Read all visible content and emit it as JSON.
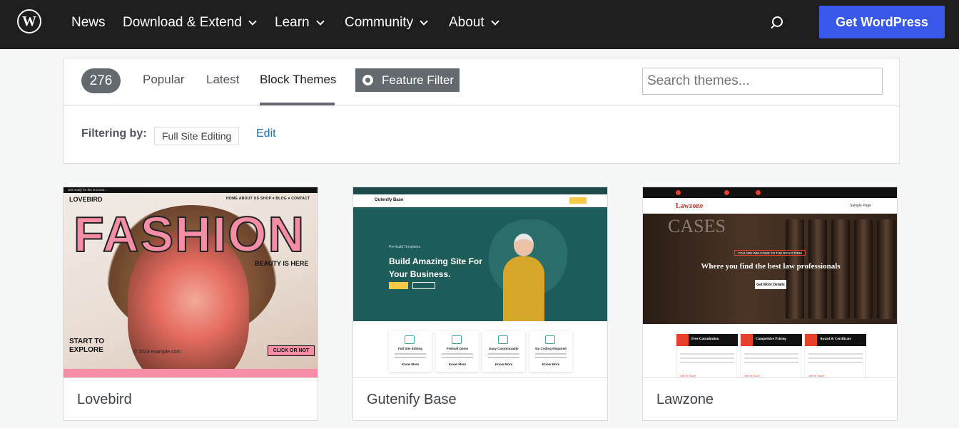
{
  "nav": {
    "logo_letter": "W",
    "items": [
      {
        "label": "News",
        "has_dropdown": false
      },
      {
        "label": "Download & Extend",
        "has_dropdown": true
      },
      {
        "label": "Learn",
        "has_dropdown": true
      },
      {
        "label": "Community",
        "has_dropdown": true
      },
      {
        "label": "About",
        "has_dropdown": true
      }
    ],
    "cta": "Get WordPress",
    "accent_color": "#3858e9"
  },
  "filters": {
    "count": "276",
    "tabs": [
      {
        "label": "Popular",
        "active": false
      },
      {
        "label": "Latest",
        "active": false
      },
      {
        "label": "Block Themes",
        "active": true
      }
    ],
    "feature_filter": "Feature Filter",
    "search_placeholder": "Search themes...",
    "filtering_by_label": "Filtering by:",
    "active_filter": "Full Site Editing",
    "edit_label": "Edit"
  },
  "themes": [
    {
      "name": "Lovebird",
      "preview": {
        "top_line": "Get ready for the success...",
        "logo": "LOVEBIRD",
        "menu": "HOME  ABOUT US  SHOP ▾  BLOG ▾  CONTACT",
        "headline": "FASHION",
        "tagline": "BEAUTY IS HERE",
        "start_line1": "START TO",
        "start_line2": "EXPLORE",
        "cta": "CLICK OR NOT",
        "copyright": "© 2023 example.com"
      }
    },
    {
      "name": "Gutenify Base",
      "preview": {
        "logo": "Gutenify Base",
        "pretitle": "Pre-build Templates",
        "title_line1": "Build Amazing Site For",
        "title_line2": "Your Business.",
        "features": [
          "Full Site Editing",
          "Prebuilt Demo",
          "Easy Customizable",
          "No Coding Required"
        ],
        "link": "Know More"
      }
    },
    {
      "name": "Lawzone",
      "preview": {
        "logo": "Lawzone",
        "menu": "Sample Page",
        "backdrop_text": "CASES",
        "tag": "YOU ARE WELCOME TO THE RIGHT FIRM",
        "title": "Where you find the best law professionals",
        "button": "Get More Details",
        "boxes": [
          "Free Consultation",
          "Competitive Pricing",
          "Award & Certificate"
        ],
        "link": "Get In Touch"
      }
    }
  ]
}
